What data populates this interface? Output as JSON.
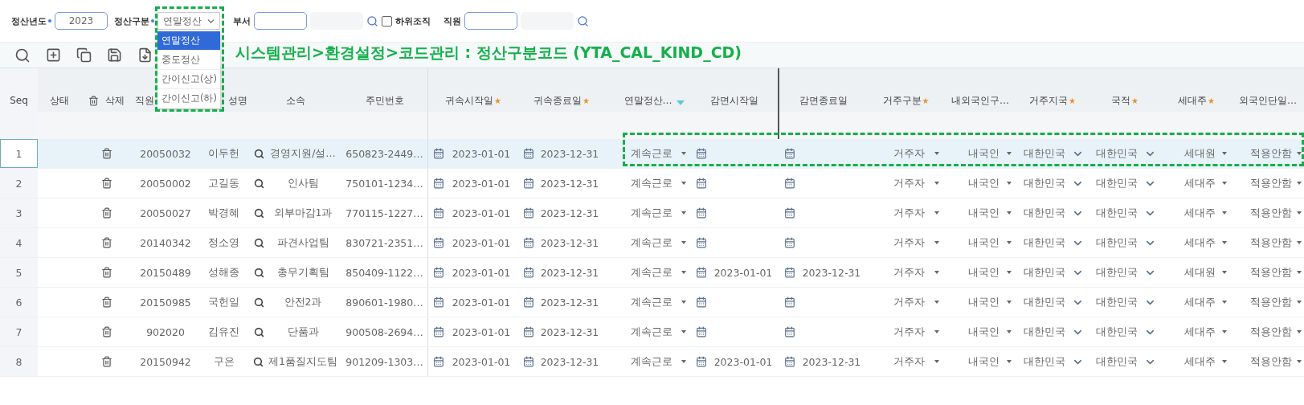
{
  "filters": {
    "year": {
      "label": "정산년도",
      "required": true,
      "value": "2023"
    },
    "kind": {
      "label": "정산구분",
      "required": true,
      "value": "연말정산"
    },
    "department": {
      "label": "부서"
    },
    "include_sub": {
      "label": "하위조직",
      "checked": false
    },
    "employee": {
      "label": "직원"
    }
  },
  "dropdown": {
    "options": [
      {
        "label": "연말정산",
        "selected": true
      },
      {
        "label": "중도정산",
        "selected": false
      },
      {
        "label": "간이신고(상)",
        "selected": false
      },
      {
        "label": "간이신고(하)",
        "selected": false
      }
    ]
  },
  "annotation": "시스템관리>환경설정>코드관리 : 정산구분코드 (YTA_CAL_KIND_CD)",
  "table": {
    "columns": [
      {
        "label": "Seq",
        "kind": "seq"
      },
      {
        "label": "상태",
        "kind": "status"
      },
      {
        "label": "삭제",
        "kind": "delete"
      },
      {
        "label": "직원",
        "kind": "text"
      },
      {
        "label": "성명",
        "kind": "text"
      },
      {
        "label": "소속",
        "kind": "lookup"
      },
      {
        "label": "주민번호",
        "kind": "text"
      },
      {
        "label": "귀속시작일",
        "kind": "date",
        "mark": "★"
      },
      {
        "label": "귀속종료일",
        "kind": "date",
        "mark": "★"
      },
      {
        "label": "연말정산…",
        "kind": "select",
        "filtered": true
      },
      {
        "label": "감면시작일",
        "kind": "date"
      },
      {
        "label": "감면종료일",
        "kind": "date"
      },
      {
        "label": "거주구분",
        "kind": "select",
        "mark": "★"
      },
      {
        "label": "내외국인구…",
        "kind": "select"
      },
      {
        "label": "거주지국",
        "kind": "chevron",
        "mark": "★"
      },
      {
        "label": "국적",
        "kind": "chevron",
        "mark": "★"
      },
      {
        "label": "세대주",
        "kind": "select",
        "mark": "★"
      },
      {
        "label": "외국인단일…",
        "kind": "select"
      }
    ],
    "rows": [
      {
        "selected": true,
        "cells": [
          "1",
          "",
          "",
          "20050032",
          "이두헌",
          "경영지원/설…",
          "650823-2449…",
          "2023-01-01",
          "2023-12-31",
          "계속근로",
          "",
          "",
          "거주자",
          "내국인",
          "대한민국",
          "대한민국",
          "세대원",
          "적용안함"
        ]
      },
      {
        "selected": false,
        "cells": [
          "2",
          "",
          "",
          "20050002",
          "고길동",
          "인사팀",
          "750101-1234…",
          "2023-01-01",
          "2023-12-31",
          "계속근로",
          "",
          "",
          "거주자",
          "내국인",
          "대한민국",
          "대한민국",
          "세대주",
          "적용안함"
        ]
      },
      {
        "selected": false,
        "cells": [
          "3",
          "",
          "",
          "20050027",
          "박경혜",
          "외부마감1과",
          "770115-1227…",
          "2023-01-01",
          "2023-12-31",
          "계속근로",
          "",
          "",
          "거주자",
          "내국인",
          "대한민국",
          "대한민국",
          "세대주",
          "적용안함"
        ]
      },
      {
        "selected": false,
        "cells": [
          "4",
          "",
          "",
          "20140342",
          "정소영",
          "파견사업팀",
          "830721-2351…",
          "2023-01-01",
          "2023-12-31",
          "계속근로",
          "",
          "",
          "거주자",
          "내국인",
          "대한민국",
          "대한민국",
          "세대주",
          "적용안함"
        ]
      },
      {
        "selected": false,
        "cells": [
          "5",
          "",
          "",
          "20150489",
          "성해종",
          "총무기획팀",
          "850409-1122…",
          "2023-01-01",
          "2023-12-31",
          "계속근로",
          "2023-01-01",
          "2023-12-31",
          "거주자",
          "내국인",
          "대한민국",
          "대한민국",
          "세대원",
          "적용안함"
        ]
      },
      {
        "selected": false,
        "cells": [
          "6",
          "",
          "",
          "20150985",
          "국헌일",
          "안전2과",
          "890601-1980…",
          "2023-01-01",
          "2023-12-31",
          "계속근로",
          "",
          "",
          "거주자",
          "내국인",
          "대한민국",
          "대한민국",
          "세대주",
          "적용안함"
        ]
      },
      {
        "selected": false,
        "cells": [
          "7",
          "",
          "",
          "902020",
          "김유진",
          "단품과",
          "900508-2694…",
          "2023-01-01",
          "2023-12-31",
          "계속근로",
          "",
          "",
          "거주자",
          "내국인",
          "대한민국",
          "대한민국",
          "세대주",
          "적용안함"
        ]
      },
      {
        "selected": false,
        "cells": [
          "8",
          "",
          "",
          "20150942",
          "구은",
          "제1품질지도팀",
          "901209-1303…",
          "2023-01-01",
          "2023-12-31",
          "계속근로",
          "2023-01-01",
          "2023-12-31",
          "거주자",
          "내국인",
          "대한민국",
          "대한민국",
          "세대주",
          "적용안함"
        ]
      }
    ]
  }
}
